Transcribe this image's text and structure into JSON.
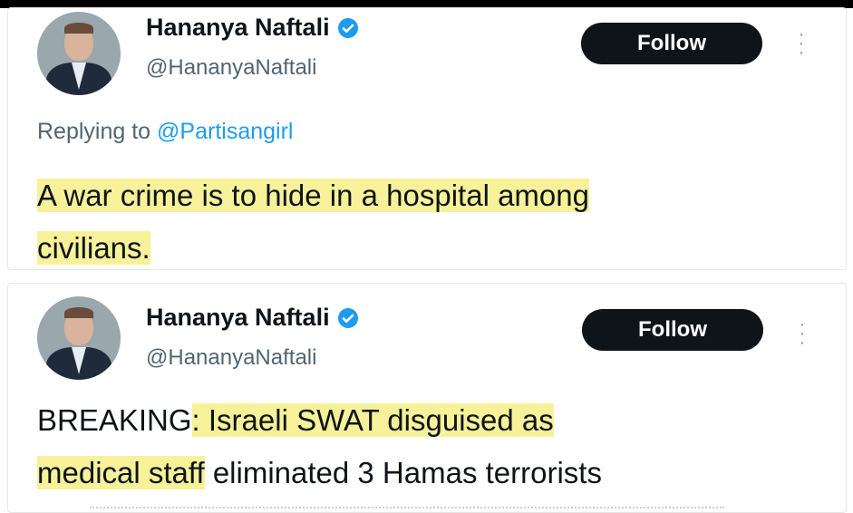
{
  "tweets": [
    {
      "author": {
        "name": "Hananya Naftali",
        "handle": "@HananyaNaftali"
      },
      "follow_label": "Follow",
      "more_icon": "more-vertical-icon",
      "reply_prefix": "Replying to",
      "reply_mention": "@Partisangirl",
      "text": {
        "line1": "A war crime is to hide in a hospital among",
        "line2": "civilians."
      }
    },
    {
      "author": {
        "name": "Hananya Naftali",
        "handle": "@HananyaNaftali"
      },
      "follow_label": "Follow",
      "more_icon": "more-vertical-icon",
      "text": {
        "prefix": "BREAKING",
        "highlight1": ": Israeli SWAT disguised as",
        "highlight2": "medical staff",
        "rest": " eliminated 3 Hamas terrorists"
      }
    }
  ],
  "colors": {
    "highlight": "#f7f29a",
    "verified": "#1d9bf0",
    "link": "#1d9bf0",
    "button_bg": "#0f1419"
  }
}
